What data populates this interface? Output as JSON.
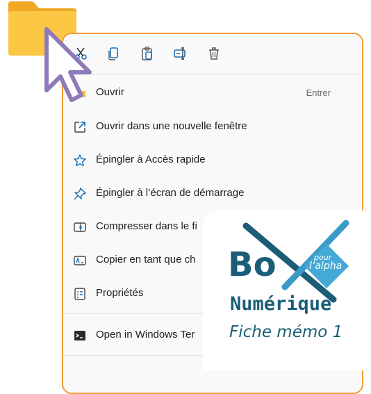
{
  "toolbar": {
    "icons": [
      "cut-icon",
      "copy-icon",
      "paste-icon",
      "rename-icon",
      "delete-icon"
    ]
  },
  "menu": {
    "items": [
      {
        "label": "Ouvrir",
        "shortcut": "Entrer",
        "icon": "folder-icon"
      },
      {
        "label": "Ouvrir dans une nouvelle fenêtre",
        "icon": "open-new-window-icon"
      },
      {
        "label": "Épingler à Accès rapide",
        "icon": "star-icon"
      },
      {
        "label": "Épingler à l’écran de démarrage",
        "icon": "pin-icon"
      },
      {
        "label": "Compresser dans le fi",
        "icon": "zip-icon"
      },
      {
        "label": "Copier en tant que ch",
        "icon": "copy-path-icon"
      },
      {
        "label": "Propriétés",
        "icon": "properties-icon"
      },
      {
        "label": "Open in Windows Ter",
        "icon": "terminal-icon"
      }
    ]
  },
  "brand": {
    "title": "Bo",
    "pour": "pour",
    "alpha": "l’alpha",
    "subtitle": "Numérique",
    "memo": "Fiche mémo 1"
  },
  "colors": {
    "accent_orange": "#f39c38",
    "brand_teal": "#1b5d78",
    "brand_light": "#45a9d6",
    "icon_blue": "#1a6fb8",
    "folder_yellow": "#f7be3a",
    "cursor_purple": "#8e7ab8"
  }
}
